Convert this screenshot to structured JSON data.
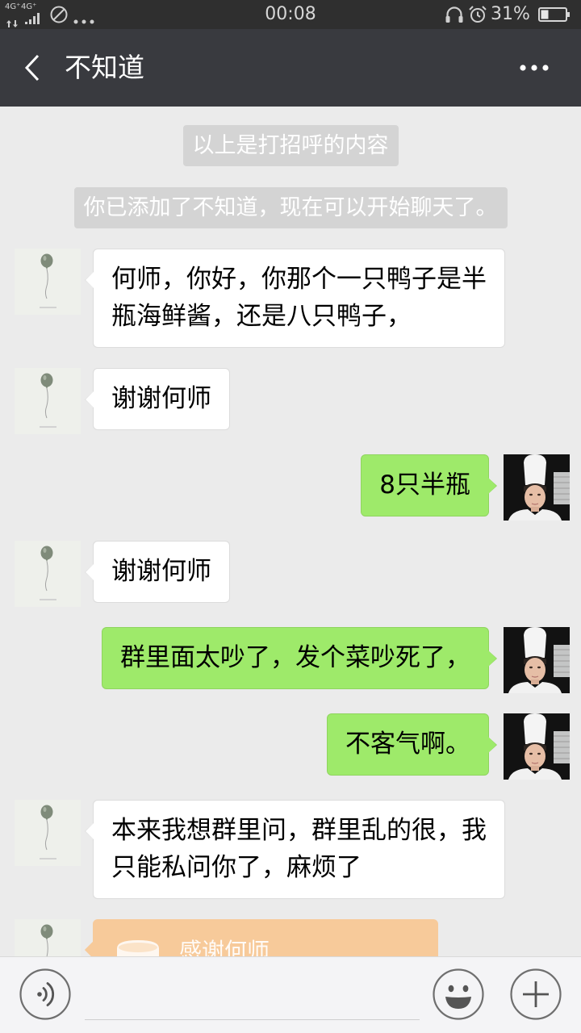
{
  "status_bar": {
    "network_labels": [
      "4G⁺",
      "4G⁺"
    ],
    "time": "00:08",
    "battery_text": "31%",
    "battery_level": 0.31,
    "icons": [
      "data-activity-icon",
      "signal-icon",
      "do-not-disturb-icon",
      "more-notifications-icon",
      "headphones-icon",
      "alarm-icon",
      "battery-icon"
    ]
  },
  "header": {
    "title": "不知道",
    "back_icon": "back-chevron-icon",
    "more_icon": "more-icon"
  },
  "chat": {
    "system_messages": [
      "以上是打招呼的内容",
      "你已添加了不知道，现在可以开始聊天了。"
    ],
    "messages": [
      {
        "direction": "incoming",
        "type": "text",
        "avatar": "balloon-avatar",
        "lines": [
          "何师，你好，你那个一只鸭子是半",
          "瓶海鲜酱，还是八只鸭子，"
        ]
      },
      {
        "direction": "incoming",
        "type": "text",
        "avatar": "balloon-avatar",
        "lines": [
          "谢谢何师"
        ]
      },
      {
        "direction": "outgoing",
        "type": "text",
        "avatar": "chef-avatar",
        "lines": [
          "8只半瓶"
        ]
      },
      {
        "direction": "incoming",
        "type": "text",
        "avatar": "balloon-avatar",
        "lines": [
          "谢谢何师"
        ]
      },
      {
        "direction": "outgoing",
        "type": "text",
        "avatar": "chef-avatar",
        "lines": [
          "群里面太吵了，发个菜吵死了，"
        ]
      },
      {
        "direction": "outgoing",
        "type": "text",
        "avatar": "chef-avatar",
        "lines": [
          "不客气啊。"
        ]
      },
      {
        "direction": "incoming",
        "type": "text",
        "avatar": "balloon-avatar",
        "lines": [
          "本来我想群里问，群里乱的很，我",
          "只能私问你了，麻烦了"
        ]
      },
      {
        "direction": "incoming",
        "type": "card",
        "avatar": "balloon-avatar",
        "icon": "gift-icon",
        "lines": [
          "感谢何师"
        ]
      }
    ]
  },
  "input_bar": {
    "input_value": "",
    "voice_icon": "voice-icon",
    "emoji_icon": "emoji-icon",
    "plus_icon": "plus-icon"
  },
  "colors": {
    "status_bar_bg": "#2f2f2f",
    "header_bg": "#393a3f",
    "chat_bg": "#ebebeb",
    "system_bubble": "#d4d4d4",
    "incoming_bubble": "#ffffff",
    "incoming_border": "#dcdcdc",
    "outgoing_bubble": "#9eea6a",
    "outgoing_border": "#8fd45f",
    "card_bubble": "#f7ca9a",
    "input_bar_bg": "#f4f4f6"
  }
}
